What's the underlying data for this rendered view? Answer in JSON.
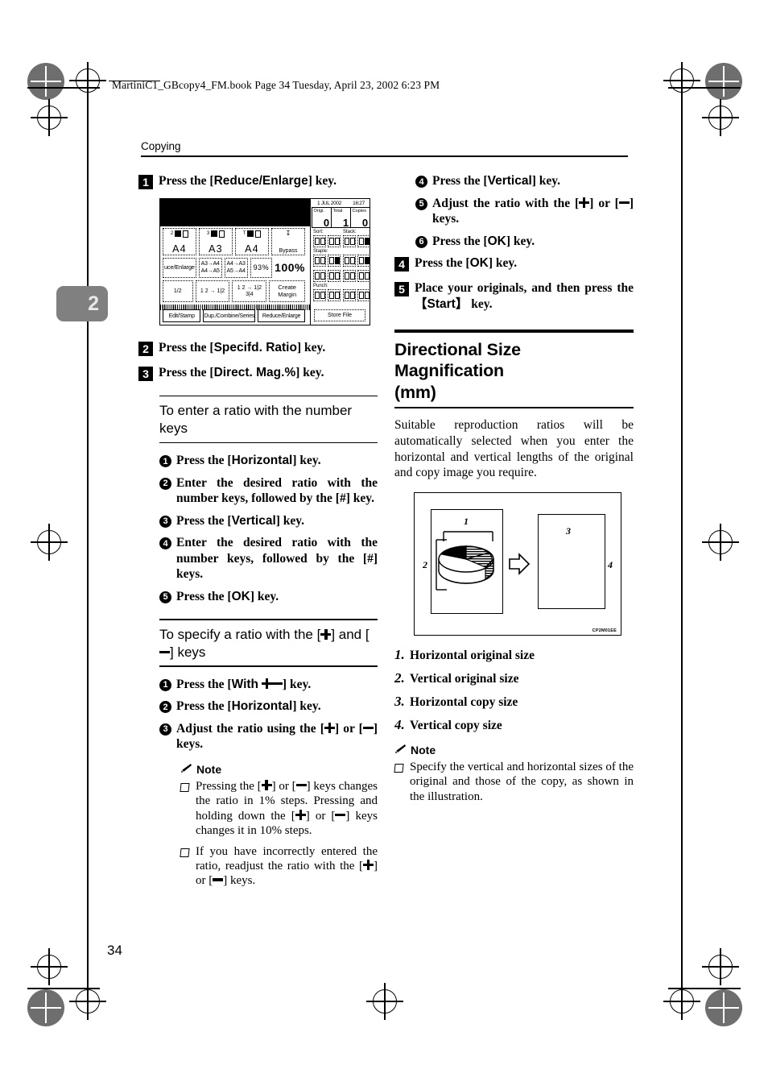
{
  "document": {
    "file_header": "MartiniC1_GBcopy4_FM.book  Page 34  Tuesday, April 23, 2002  6:23 PM",
    "running_head": "Copying",
    "chapter_tab": "2",
    "page_number": "34"
  },
  "left_column": {
    "step1": {
      "num": "1",
      "text_prefix": "Press the [",
      "key": "Reduce/Enlarge",
      "text_suffix": "] key."
    },
    "step2": {
      "num": "2",
      "text_prefix": "Press the [",
      "key": "Specifd. Ratio",
      "text_suffix": "] key."
    },
    "step3": {
      "num": "3",
      "text_prefix": "Press the [",
      "key": "Direct. Mag.%",
      "text_suffix": "] key."
    },
    "subhead_numberkeys": "To enter a ratio with the number keys",
    "numberkeys_steps": [
      {
        "num": "1",
        "prefix": "Press the [",
        "key": "Horizontal",
        "suffix": "] key."
      },
      {
        "num": "2",
        "text": "Enter the desired ratio with the number keys, followed by the [#] key."
      },
      {
        "num": "3",
        "prefix": "Press the [",
        "key": "Vertical",
        "suffix": "] key."
      },
      {
        "num": "4",
        "text": "Enter the desired ratio with the number keys, followed by the [#] keys."
      },
      {
        "num": "5",
        "prefix": "Press the [",
        "key": "OK",
        "suffix": "] key."
      }
    ],
    "subhead_plusminus_line1": "To specify a ratio with the [",
    "subhead_plusminus_line2": "] and [",
    "subhead_plusminus_line3": "] keys",
    "plusminus_steps": [
      {
        "num": "1",
        "prefix": "Press the [",
        "key": "With",
        "suffix": "] key."
      },
      {
        "num": "2",
        "prefix": "Press the [",
        "key": "Horizontal",
        "suffix": "] key."
      },
      {
        "num": "3",
        "prefix": "Adjust the ratio using the [",
        "suffix": "] or [",
        "suffix2": "] keys."
      }
    ],
    "note_label": "Note",
    "notes": [
      {
        "part1": "Pressing the [",
        "part2": "] or [",
        "part3": "] keys changes the ratio in 1% steps. Pressing and holding down the [",
        "part4": "] or [",
        "part5": "] keys changes it in 10% steps."
      },
      {
        "part1": "If you have incorrectly entered the ratio, readjust the ratio with the [",
        "part2": "] or [",
        "part3": "] keys."
      }
    ]
  },
  "right_column": {
    "continued_substeps": [
      {
        "num": "4",
        "prefix": "Press the [",
        "key": "Vertical",
        "suffix": "] key."
      },
      {
        "num": "5",
        "prefix": "Adjust the ratio with the [",
        "suffix": "] or [",
        "suffix2": "] keys."
      },
      {
        "num": "6",
        "prefix": "Press the [",
        "key": "OK",
        "suffix": "] key."
      }
    ],
    "step4": {
      "num": "4",
      "prefix": "Press the [",
      "key": "OK",
      "suffix": "] key."
    },
    "step5": {
      "num": "5",
      "prefix": "Place your originals, and then press the 【",
      "key": "Start",
      "suffix": "】 key."
    },
    "section_heading_line1": "Directional Size Magnification",
    "section_heading_line2": "(mm)",
    "body_text": "Suitable reproduction ratios will be automatically selected when you enter the horizontal and vertical lengths of the original and copy image you require.",
    "illustration": {
      "code": "CP2M01EE",
      "labels": {
        "l1": "1",
        "l2": "2",
        "l3": "3",
        "l4": "4"
      }
    },
    "caption_list": [
      {
        "num": "1.",
        "text": "Horizontal original size"
      },
      {
        "num": "2.",
        "text": "Vertical original size"
      },
      {
        "num": "3.",
        "text": "Horizontal copy size"
      },
      {
        "num": "4.",
        "text": "Vertical copy size"
      }
    ],
    "note_label": "Note",
    "notes": [
      {
        "text": "Specify the vertical and horizontal sizes of the original and those of the copy, as shown in the illustration."
      }
    ]
  },
  "lcd_panel": {
    "clock": {
      "date": "1 JUL  2002",
      "time": "16:27"
    },
    "counters": [
      {
        "label": "Origi.",
        "value": "0"
      },
      {
        "label": "Total",
        "value": "1"
      },
      {
        "label": "Copies",
        "value": "0"
      }
    ],
    "tray_buttons": [
      {
        "index": "2",
        "size": "A4"
      },
      {
        "index": "3",
        "size": "A3"
      },
      {
        "index": "T",
        "size": "A4"
      },
      {
        "index": "",
        "size": "Bypass"
      }
    ],
    "ratio_buttons": [
      {
        "label": "uce/Enlarge"
      },
      {
        "line1": "A3→A4",
        "line2": "A4→A5"
      },
      {
        "line1": "A4→A3",
        "line2": "A5→A4"
      },
      {
        "label": "93%"
      },
      {
        "label": "100%"
      }
    ],
    "function_buttons": [
      {
        "label": "1/2"
      },
      {
        "label": "1 2 → 1|2"
      },
      {
        "label": "1 2 → 1|2 3|4"
      },
      {
        "line1": "Create",
        "line2": "Margin"
      }
    ],
    "tabs": [
      {
        "label": "Edit/Stamp"
      },
      {
        "label": "Dup./Combine/Series"
      },
      {
        "label": "Reduce/Enlarge"
      }
    ],
    "finisher_labels": {
      "sort": "Sort:",
      "stack": "Stack:",
      "staple": "Staple:",
      "punch": "Punch:"
    },
    "store_file": "Store File"
  }
}
